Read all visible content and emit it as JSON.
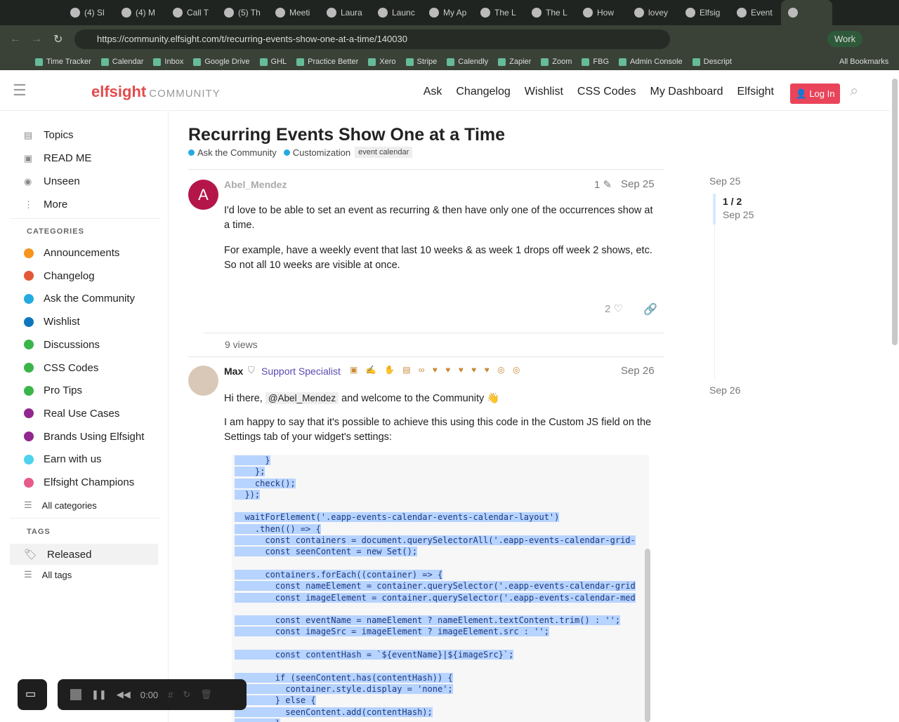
{
  "browser": {
    "tabs": [
      "(4) Sl",
      "(4) M",
      "Call T",
      "(5) Th",
      "Meeti",
      "Laura",
      "Launc",
      "My Ap",
      "The L",
      "The L",
      "How",
      "lovey",
      "Elfsig",
      "Event",
      ""
    ],
    "url": "https://community.elfsight.com/t/recurring-events-show-one-at-a-time/140030",
    "profile": "Work",
    "bookmarks": [
      "Time Tracker",
      "Calendar",
      "Inbox",
      "Google Drive",
      "GHL",
      "Practice Better",
      "Xero",
      "Stripe",
      "Calendly",
      "Zapier",
      "Zoom",
      "FBG",
      "Admin Console",
      "Descript"
    ],
    "all_bookmarks": "All Bookmarks"
  },
  "header": {
    "logo": "elfsight",
    "logo_sub": "COMMUNITY",
    "nav": [
      "Ask",
      "Changelog",
      "Wishlist",
      "CSS Codes",
      "My Dashboard",
      "Elfsight"
    ],
    "login": "Log In"
  },
  "sidebar": {
    "top": [
      "Topics",
      "READ ME",
      "Unseen",
      "More"
    ],
    "categories_title": "CATEGORIES",
    "categories": [
      {
        "label": "Announcements",
        "color": "#f7941d"
      },
      {
        "label": "Changelog",
        "color": "#e45735"
      },
      {
        "label": "Ask the Community",
        "color": "#25aae1"
      },
      {
        "label": "Wishlist",
        "color": "#0e76bd"
      },
      {
        "label": "Discussions",
        "color": "#3ab54a"
      },
      {
        "label": "CSS Codes",
        "color": "#3ab54a"
      },
      {
        "label": "Pro Tips",
        "color": "#3ab54a"
      },
      {
        "label": "Real Use Cases",
        "color": "#92278f"
      },
      {
        "label": "Brands Using Elfsight",
        "color": "#92278f"
      },
      {
        "label": "Earn with us",
        "color": "#4fd1f0"
      },
      {
        "label": "Elfsight Champions",
        "color": "#e85a8a"
      }
    ],
    "all_categories": "All categories",
    "tags_title": "TAGS",
    "tags": [
      "Released"
    ],
    "all_tags": "All tags"
  },
  "topic": {
    "title": "Recurring Events Show One at a Time",
    "category": "Ask the Community",
    "subcategory": "Customization",
    "tag": "event calendar",
    "post1": {
      "author": "Abel_Mendez",
      "edits": "1",
      "date": "Sep 25",
      "avatar": "A",
      "p1": "I'd love to be able to set an event as recurring & then have only one of the occurrences show at a time.",
      "p2": "For example, have a weekly event that last 10 weeks & as week 1 drops off week 2 shows, etc. So not all 10 weeks are visible at once.",
      "likes": "2",
      "views": "9 views"
    },
    "post2": {
      "author": "Max",
      "title": "Support Specialist",
      "date": "Sep 26",
      "greeting": "Hi there,",
      "mention": "@Abel_Mendez",
      "greeting_rest": "and welcome to the Community 👋",
      "p2": "I am happy to say that it's possible to achieve this using this code in the Custom JS field on the Settings tab of your widget's settings:",
      "code": [
        "      }",
        "    };",
        "    check();",
        "  });",
        "",
        "  waitForElement('.eapp-events-calendar-events-calendar-layout')",
        "    .then(() => {",
        "      const containers = document.querySelectorAll('.eapp-events-calendar-grid-",
        "      const seenContent = new Set();",
        "",
        "      containers.forEach((container) => {",
        "        const nameElement = container.querySelector('.eapp-events-calendar-grid",
        "        const imageElement = container.querySelector('.eapp-events-calendar-med",
        "",
        "        const eventName = nameElement ? nameElement.textContent.trim() : '';",
        "        const imageSrc = imageElement ? imageElement.src : '';",
        "",
        "        const contentHash = `${eventName}|${imageSrc}`;",
        "",
        "        if (seenContent.has(contentHash)) {",
        "          container.style.display = 'none';",
        "        } else {",
        "          seenContent.add(contentHash);",
        "        }"
      ]
    }
  },
  "timeline": {
    "start": "Sep 25",
    "position": "1 / 2",
    "position_date": "Sep 25",
    "end": "Sep 26"
  },
  "recorder": {
    "time": "0:00"
  }
}
